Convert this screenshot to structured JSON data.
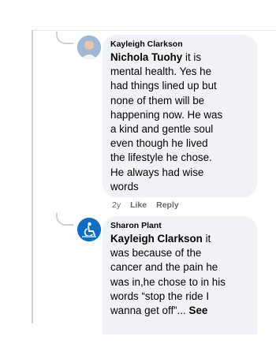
{
  "comments": [
    {
      "author": "Kayleigh Clarkson",
      "mention": "Nichola Tuohy",
      "text_lines": [
        "it is",
        "mental health. Yes he",
        "had things lined up but",
        "none of them will be",
        "happening now. He was",
        "a kind and gentle soul",
        "even though he lived",
        "the lifestyle he chose.",
        "He always had wise",
        "words"
      ],
      "meta": {
        "age": "2y",
        "like": "Like",
        "reply": "Reply"
      }
    },
    {
      "author": "Sharon Plant",
      "mention": "Kayleigh Clarkson",
      "text_lines": [
        "it",
        "was because of the",
        "cancer and the pain he",
        "was in,he chose to in his",
        "words “stop the ride I",
        "wanna get off”..."
      ],
      "see_more": "See"
    }
  ],
  "icons": {
    "avatar_1": "profile-photo-avatar",
    "avatar_2": "wheelchair-logo-avatar"
  },
  "colors": {
    "bubble": "#f0f2f5",
    "meta_text": "#65676b",
    "thread_line": "#ced0d4",
    "avatar_2_bg": "#0b6fc8"
  }
}
